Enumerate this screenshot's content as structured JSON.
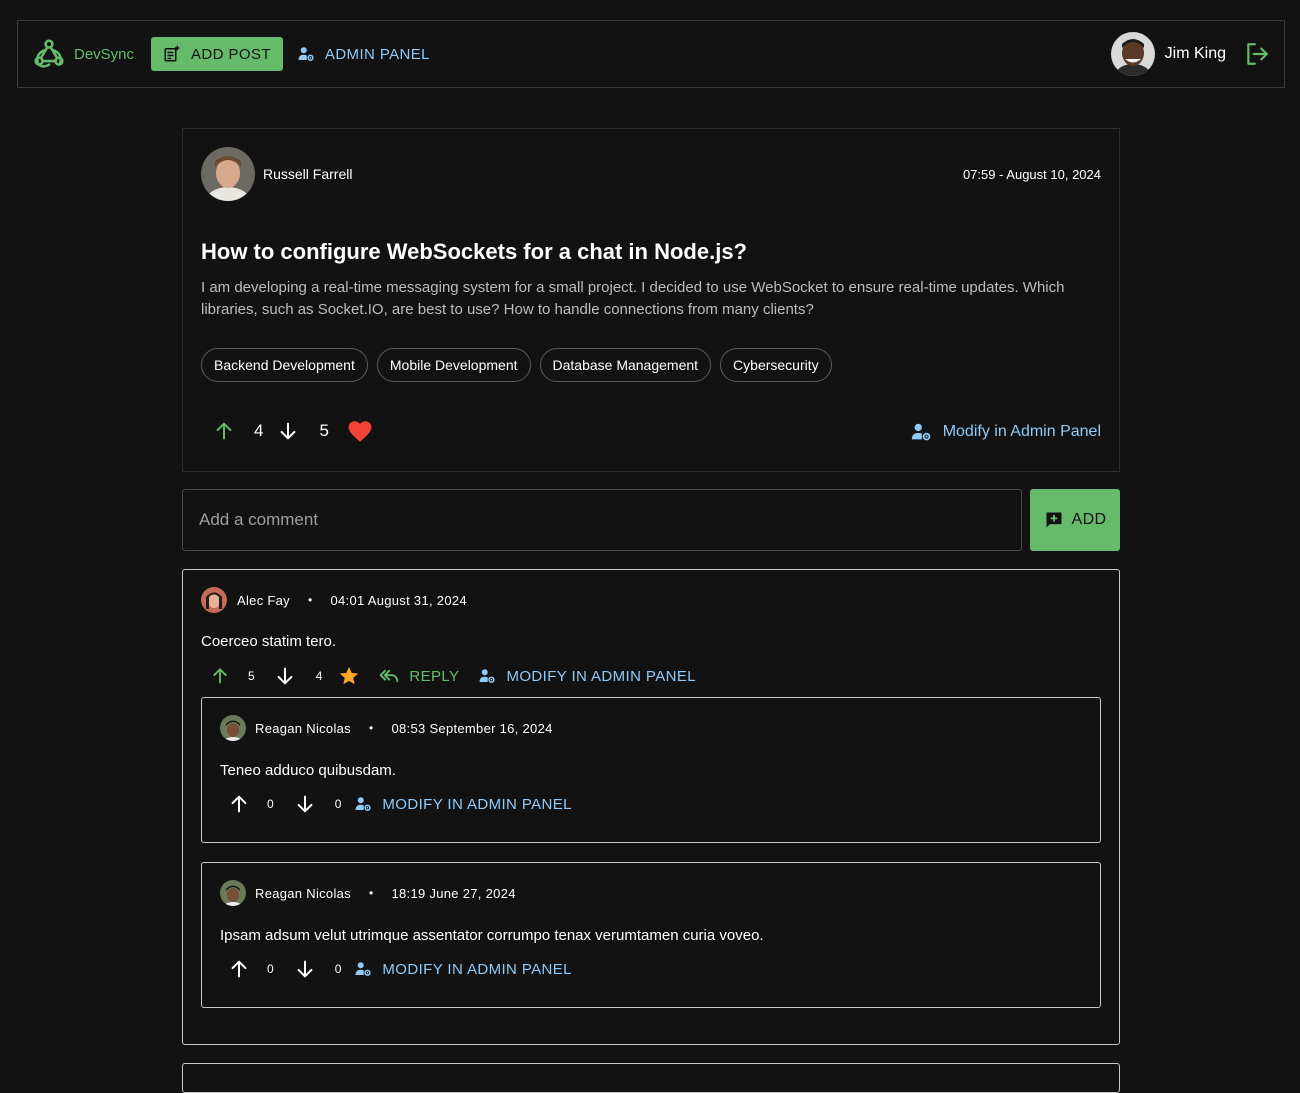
{
  "nav": {
    "brand": "DevSync",
    "add_post": "ADD POST",
    "admin_panel": "ADMIN PANEL",
    "user_name": "Jim King"
  },
  "post": {
    "author": "Russell Farrell",
    "date": "07:59 - August 10, 2024",
    "title": "How to configure WebSockets for a chat in Node.js?",
    "body": "I am developing a real-time messaging system for a small project. I decided to use WebSocket to ensure real-time updates. Which libraries, such as Socket.IO, are best to use? How to handle connections from many clients?",
    "tags": [
      "Backend Development",
      "Mobile Development",
      "Database Management",
      "Cybersecurity"
    ],
    "upvotes": "4",
    "downvotes": "5",
    "modify": "Modify in Admin Panel"
  },
  "comment_form": {
    "placeholder": "Add a comment",
    "add": "ADD"
  },
  "comments": [
    {
      "author": "Alec Fay",
      "date": "04:01 August 31, 2024",
      "text": "Coerceo statim tero.",
      "upvotes": "5",
      "downvotes": "4",
      "reply": "REPLY",
      "modify": "MODIFY IN ADMIN PANEL",
      "replies": [
        {
          "author": "Reagan Nicolas",
          "date": "08:53 September 16, 2024",
          "text": "Teneo adduco quibusdam.",
          "upvotes": "0",
          "downvotes": "0",
          "modify": "MODIFY IN ADMIN PANEL"
        },
        {
          "author": "Reagan Nicolas",
          "date": "18:19 June 27, 2024",
          "text": "Ipsam adsum velut utrimque assentator corrumpo tenax verumtamen curia voveo.",
          "upvotes": "0",
          "downvotes": "0",
          "modify": "MODIFY IN ADMIN PANEL"
        }
      ]
    }
  ],
  "colors": {
    "background": "#121212",
    "accent_green": "#66bb6a",
    "link_blue": "#90caf9",
    "heart_red": "#f44336",
    "star_orange": "#ffa726"
  },
  "icons": [
    "webhook-logo-icon",
    "post-add-icon",
    "admin-icon",
    "logout-icon",
    "arrow-up-icon",
    "arrow-down-icon",
    "heart-icon",
    "star-icon",
    "reply-all-icon",
    "add-comment-icon"
  ]
}
